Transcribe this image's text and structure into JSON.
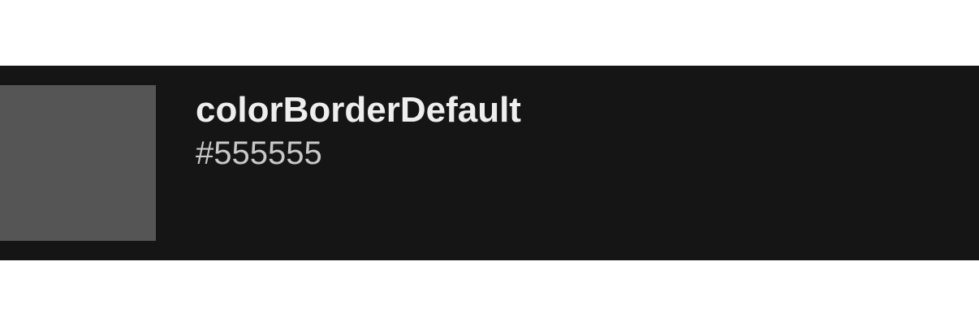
{
  "token": {
    "name": "colorBorderDefault",
    "value": "#555555",
    "swatch_color": "#555555"
  },
  "colors": {
    "row_background": "#151515",
    "name_text": "#eeeeee",
    "value_text": "#c8c8c8",
    "page_background": "#ffffff"
  }
}
